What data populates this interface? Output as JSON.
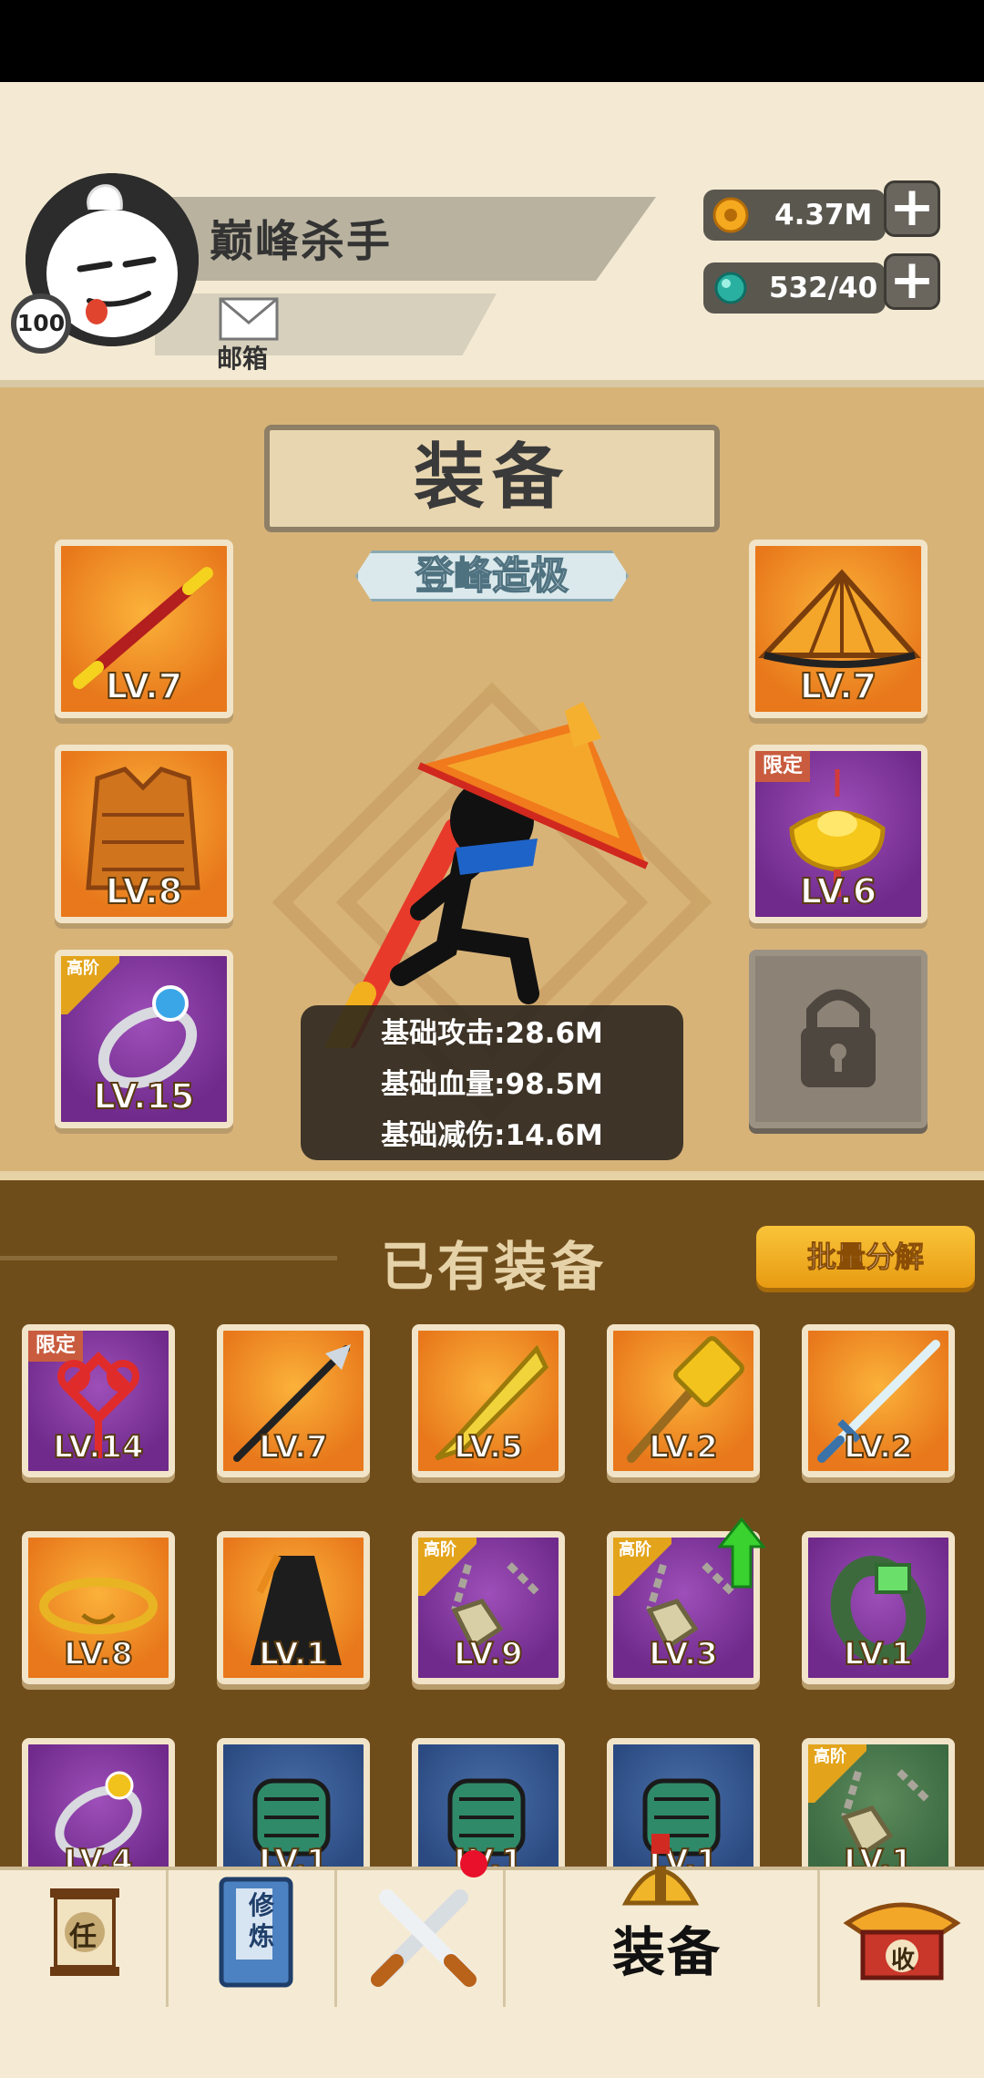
{
  "profile": {
    "name": "巅峰杀手",
    "level": "100",
    "mail_label": "邮箱"
  },
  "currency": {
    "gold": "4.37M",
    "gems": "532/40"
  },
  "equip": {
    "title": "装备",
    "rank": "登峰造极",
    "slots": [
      {
        "level": "LV.7",
        "tag": ""
      },
      {
        "level": "LV.8",
        "tag": ""
      },
      {
        "level": "LV.15",
        "tag": "高阶"
      },
      {
        "level": "LV.7",
        "tag": ""
      },
      {
        "level": "LV.6",
        "tag": "限定"
      }
    ],
    "stats": [
      "基础攻击:28.6M",
      "基础血量:98.5M",
      "基础减伤:14.6M"
    ]
  },
  "inventory": {
    "title": "已有装备",
    "decompose_label": "批量分解",
    "items": [
      {
        "level": "LV.14",
        "tag": "限定"
      },
      {
        "level": "LV.7",
        "tag": ""
      },
      {
        "level": "LV.5",
        "tag": ""
      },
      {
        "level": "LV.2",
        "tag": ""
      },
      {
        "level": "LV.2",
        "tag": ""
      },
      {
        "level": "LV.8",
        "tag": ""
      },
      {
        "level": "LV.1",
        "tag": ""
      },
      {
        "level": "LV.9",
        "tag": "高阶"
      },
      {
        "level": "LV.3",
        "tag": "高阶"
      },
      {
        "level": "LV.1",
        "tag": ""
      },
      {
        "level": "LV.4",
        "tag": ""
      },
      {
        "level": "LV.1",
        "tag": ""
      },
      {
        "level": "LV.1",
        "tag": ""
      },
      {
        "level": "LV.1",
        "tag": ""
      },
      {
        "level": "LV.1",
        "tag": "高阶"
      }
    ]
  },
  "nav": {
    "mission_glyph": "任",
    "cultivate_glyph": "修炼",
    "equip_label": "装备",
    "collect_glyph": "收"
  },
  "colors": {
    "orange": "#e8781b",
    "purple": "#6f2a8b",
    "brown": "#6f4d1b",
    "gold_button": "#f9c43a"
  }
}
